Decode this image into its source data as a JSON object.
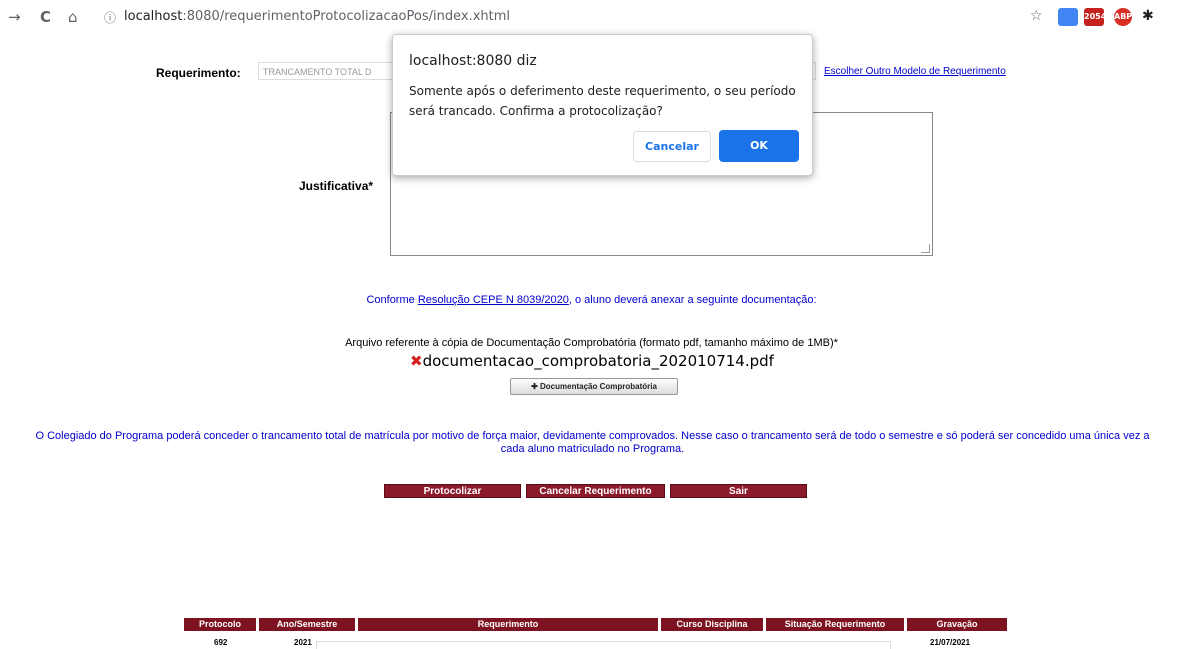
{
  "browser": {
    "back_icon": "→",
    "reload_icon": "C",
    "home_icon": "⌂",
    "info_icon": "ⓘ",
    "url_host": "localhost",
    "url_rest": ":8080/requerimentoProtocolizacaoPos/index.xhtml",
    "star_icon": "☆",
    "ext_badge": "2054",
    "abp_label": "ABP",
    "puzzle_icon": "✱"
  },
  "form": {
    "requerimento_label": "Requerimento:",
    "requerimento_value": "TRANCAMENTO TOTAL D",
    "escolher_link": "Escolher Outro Modelo de Requerimento",
    "justificativa_label": "Justificativa*",
    "conforme_prefix": "Conforme ",
    "conforme_link": "Resolução CEPE N 8039/2020",
    "conforme_suffix": ", o aluno deverá anexar a seguinte documentação:",
    "arquivo_text": "Arquivo referente à cópia de Documentação Comprobatória (formato pdf, tamanho máximo de 1MB)*",
    "file_remove_icon": "✖",
    "file_name": "documentacao_comprobatoria_202010714.pdf",
    "add_doc_button": "✚ Documentação Comprobatória",
    "colegiado_text": "O Colegiado do Programa poderá conceder o trancamento total de matrícula por motivo de força maior, devidamente comprovados. Nesse caso o trancamento será de todo o semestre e só poderá ser concedido uma única vez a cada aluno matriculado no Programa.",
    "buttons": {
      "protocolizar": "Protocolizar",
      "cancelar": "Cancelar Requerimento",
      "sair": "Sair"
    }
  },
  "table": {
    "headers": [
      "Protocolo",
      "Ano/Semestre",
      "Requerimento",
      "Curso Disciplina",
      "Situação Requerimento",
      "Gravação"
    ],
    "row": {
      "protocolo": "692",
      "ano": "2021",
      "gravacao": "21/07/2021"
    }
  },
  "dialog": {
    "title": "localhost:8080 diz",
    "message": "Somente após o deferimento deste requerimento, o seu período será trancado. Confirma a protocolização?",
    "cancel_label": "Cancelar",
    "ok_label": "OK"
  },
  "colors": {
    "accent_red": "#8b1a2b",
    "link_blue": "#0000cc",
    "dialog_blue": "#1a73e8"
  }
}
